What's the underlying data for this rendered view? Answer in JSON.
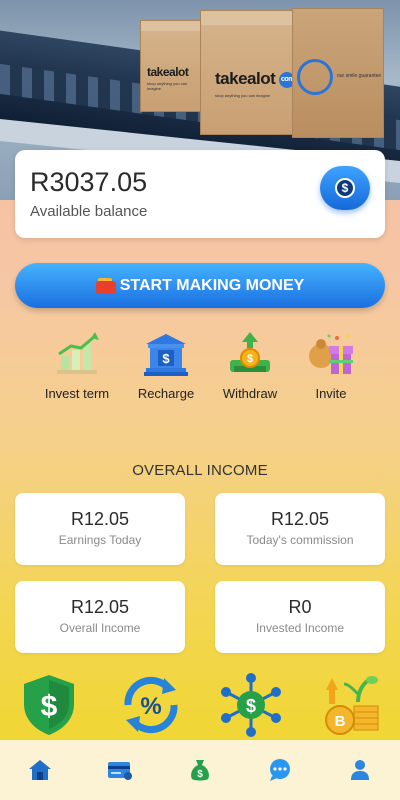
{
  "hero": {
    "brand": "takealot",
    "brand_suffix": "com",
    "tagline": "shop anything you can imagine",
    "guarantee": "our smile guarantee"
  },
  "balance": {
    "amount": "R3037.05",
    "label": "Available balance",
    "coin_symbol": "$"
  },
  "start_button": {
    "label": "START MAKING MONEY"
  },
  "actions": [
    {
      "label": "Invest term",
      "icon": "bar-chart-growth-icon"
    },
    {
      "label": "Recharge",
      "icon": "bank-icon"
    },
    {
      "label": "Withdraw",
      "icon": "money-withdraw-icon"
    },
    {
      "label": "Invite",
      "icon": "gift-icon"
    }
  ],
  "income": {
    "title": "OVERALL INCOME",
    "stats": [
      {
        "value": "R12.05",
        "label": "Earnings Today"
      },
      {
        "value": "R12.05",
        "label": "Today's commission"
      },
      {
        "value": "R12.05",
        "label": "Overall Income"
      },
      {
        "value": "R0",
        "label": "Invested Income"
      }
    ]
  },
  "features": [
    {
      "icon": "shield-dollar-icon"
    },
    {
      "icon": "percent-refresh-icon"
    },
    {
      "icon": "dollar-network-icon"
    },
    {
      "icon": "coin-growth-icon"
    }
  ],
  "nav": [
    {
      "icon": "home-icon",
      "active": true
    },
    {
      "icon": "card-icon"
    },
    {
      "icon": "money-bag-icon"
    },
    {
      "icon": "chat-icon"
    },
    {
      "icon": "user-icon"
    }
  ],
  "colors": {
    "accent_blue": "#1a6fe0",
    "green": "#2fa84f",
    "text_dark": "#2b2b2b",
    "nav_bg": "#fbf3d4"
  }
}
